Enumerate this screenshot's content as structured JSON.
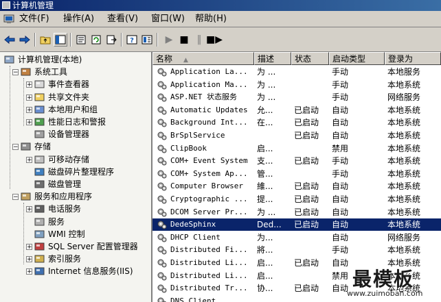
{
  "window": {
    "title": "计算机管理"
  },
  "menu": [
    "文件(F)",
    "操作(A)",
    "查看(V)",
    "窗口(W)",
    "帮助(H)"
  ],
  "toolbar": {
    "buttons": [
      "back-icon",
      "forward-icon",
      "up-folder-icon",
      "show-hide-tree-icon",
      "properties-icon",
      "refresh-icon",
      "export-icon",
      "help-icon",
      "view-icon",
      "play-icon",
      "stop-icon",
      "pause-icon",
      "restart-icon"
    ]
  },
  "tree": {
    "items": [
      {
        "label": "计算机管理(本地)",
        "level": 0,
        "expander": "",
        "icon": "computer-icon"
      },
      {
        "label": "系统工具",
        "level": 1,
        "expander": "−",
        "icon": "tools-icon"
      },
      {
        "label": "事件查看器",
        "level": 2,
        "expander": "+",
        "icon": "event-viewer-icon"
      },
      {
        "label": "共享文件夹",
        "level": 2,
        "expander": "+",
        "icon": "shared-folder-icon"
      },
      {
        "label": "本地用户和组",
        "level": 2,
        "expander": "+",
        "icon": "users-icon"
      },
      {
        "label": "性能日志和警报",
        "level": 2,
        "expander": "+",
        "icon": "performance-icon"
      },
      {
        "label": "设备管理器",
        "level": 2,
        "expander": "",
        "icon": "device-manager-icon"
      },
      {
        "label": "存储",
        "level": 1,
        "expander": "−",
        "icon": "storage-icon"
      },
      {
        "label": "可移动存储",
        "level": 2,
        "expander": "+",
        "icon": "removable-storage-icon"
      },
      {
        "label": "磁盘碎片整理程序",
        "level": 2,
        "expander": "",
        "icon": "defrag-icon"
      },
      {
        "label": "磁盘管理",
        "level": 2,
        "expander": "",
        "icon": "disk-management-icon"
      },
      {
        "label": "服务和应用程序",
        "level": 1,
        "expander": "−",
        "icon": "services-apps-icon"
      },
      {
        "label": "电话服务",
        "level": 2,
        "expander": "+",
        "icon": "telephony-icon"
      },
      {
        "label": "服务",
        "level": 2,
        "expander": "",
        "icon": "services-icon"
      },
      {
        "label": "WMI 控制",
        "level": 2,
        "expander": "",
        "icon": "wmi-icon"
      },
      {
        "label": "SQL Server 配置管理器",
        "level": 2,
        "expander": "+",
        "icon": "sql-server-icon"
      },
      {
        "label": "索引服务",
        "level": 2,
        "expander": "+",
        "icon": "indexing-icon"
      },
      {
        "label": "Internet 信息服务(IIS)",
        "level": 2,
        "expander": "+",
        "icon": "iis-icon"
      }
    ]
  },
  "list": {
    "columns": [
      "名称",
      "描述",
      "状态",
      "启动类型",
      "登录为"
    ],
    "sort_indicator": "▲",
    "rows": [
      {
        "name": "Application La...",
        "desc": "为 ...",
        "status": "",
        "startup": "手动",
        "logon": "本地服务"
      },
      {
        "name": "Application Ma...",
        "desc": "为 ...",
        "status": "",
        "startup": "手动",
        "logon": "本地系统"
      },
      {
        "name": "ASP.NET 状态服务",
        "desc": "为 ...",
        "status": "",
        "startup": "手动",
        "logon": "网络服务"
      },
      {
        "name": "Automatic Updates",
        "desc": "允...",
        "status": "已启动",
        "startup": "自动",
        "logon": "本地系统"
      },
      {
        "name": "Background Int...",
        "desc": "在...",
        "status": "已启动",
        "startup": "自动",
        "logon": "本地系统"
      },
      {
        "name": "BrSplService",
        "desc": "",
        "status": "已启动",
        "startup": "自动",
        "logon": "本地系统"
      },
      {
        "name": "ClipBook",
        "desc": "启...",
        "status": "",
        "startup": "禁用",
        "logon": "本地系统"
      },
      {
        "name": "COM+ Event System",
        "desc": "支...",
        "status": "已启动",
        "startup": "手动",
        "logon": "本地系统"
      },
      {
        "name": "COM+ System Ap...",
        "desc": "管...",
        "status": "",
        "startup": "手动",
        "logon": "本地系统"
      },
      {
        "name": "Computer Browser",
        "desc": "維...",
        "status": "已启动",
        "startup": "自动",
        "logon": "本地系统"
      },
      {
        "name": "Cryptographic ...",
        "desc": "提...",
        "status": "已启动",
        "startup": "自动",
        "logon": "本地系统"
      },
      {
        "name": "DCOM Server Pr...",
        "desc": "为 ...",
        "status": "已启动",
        "startup": "自动",
        "logon": "本地系统"
      },
      {
        "name": "DedeSphinx",
        "desc": "Ded...",
        "status": "已启动",
        "startup": "自动",
        "logon": "本地系统",
        "selected": true
      },
      {
        "name": "DHCP Client",
        "desc": "为...",
        "status": "",
        "startup": "自动",
        "logon": "网络服务"
      },
      {
        "name": "Distributed Fi...",
        "desc": "將...",
        "status": "",
        "startup": "手动",
        "logon": "本地系统"
      },
      {
        "name": "Distributed Li...",
        "desc": "启...",
        "status": "已启动",
        "startup": "自动",
        "logon": "本地系统"
      },
      {
        "name": "Distributed Li...",
        "desc": "启...",
        "status": "",
        "startup": "禁用",
        "logon": "本地系统"
      },
      {
        "name": "Distributed Tr...",
        "desc": "协...",
        "status": "已启动",
        "startup": "自动",
        "logon": "本地系统"
      },
      {
        "name": "DNS Client",
        "desc": "",
        "status": "",
        "startup": "",
        "logon": ""
      }
    ]
  },
  "watermark": {
    "text": "最模板",
    "url": "www.zuimoban.com"
  }
}
